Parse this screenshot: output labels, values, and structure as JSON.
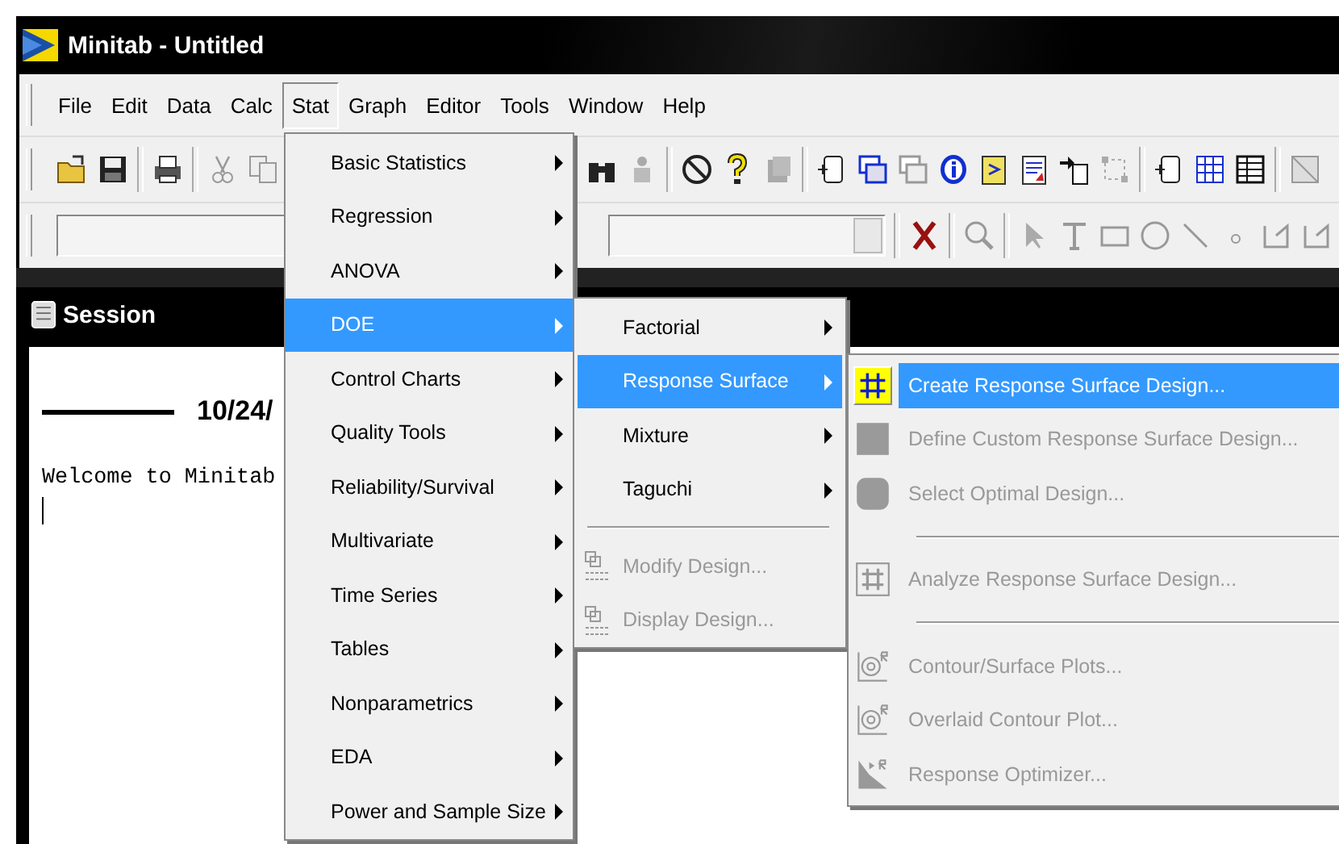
{
  "window": {
    "title": "Minitab - Untitled"
  },
  "menu_bar": [
    {
      "label": "File",
      "selected": false
    },
    {
      "label": "Edit",
      "selected": false
    },
    {
      "label": "Data",
      "selected": false
    },
    {
      "label": "Calc",
      "selected": false
    },
    {
      "label": "Stat",
      "selected": true
    },
    {
      "label": "Graph",
      "selected": false
    },
    {
      "label": "Editor",
      "selected": false
    },
    {
      "label": "Tools",
      "selected": false
    },
    {
      "label": "Window",
      "selected": false
    },
    {
      "label": "Help",
      "selected": false
    }
  ],
  "session": {
    "title": "Session",
    "date": "10/24/",
    "text": "Welcome to Minitab"
  },
  "stat_menu": [
    {
      "label": "Basic Statistics",
      "selected": false,
      "submenu": true
    },
    {
      "label": "Regression",
      "selected": false,
      "submenu": true
    },
    {
      "label": "ANOVA",
      "selected": false,
      "submenu": true
    },
    {
      "label": "DOE",
      "selected": true,
      "submenu": true
    },
    {
      "label": "Control Charts",
      "selected": false,
      "submenu": true
    },
    {
      "label": "Quality Tools",
      "selected": false,
      "submenu": true
    },
    {
      "label": "Reliability/Survival",
      "selected": false,
      "submenu": true
    },
    {
      "label": "Multivariate",
      "selected": false,
      "submenu": true
    },
    {
      "label": "Time Series",
      "selected": false,
      "submenu": true
    },
    {
      "label": "Tables",
      "selected": false,
      "submenu": true
    },
    {
      "label": "Nonparametrics",
      "selected": false,
      "submenu": true
    },
    {
      "label": "EDA",
      "selected": false,
      "submenu": true
    },
    {
      "label": "Power and Sample Size",
      "selected": false,
      "submenu": true
    }
  ],
  "doe_menu": [
    {
      "kind": "item",
      "label": "Factorial",
      "selected": false,
      "disabled": false,
      "submenu": true
    },
    {
      "kind": "item",
      "label": "Response Surface",
      "selected": true,
      "disabled": false,
      "submenu": true
    },
    {
      "kind": "item",
      "label": "Mixture",
      "selected": false,
      "disabled": false,
      "submenu": true
    },
    {
      "kind": "item",
      "label": "Taguchi",
      "selected": false,
      "disabled": false,
      "submenu": true
    },
    {
      "kind": "separator"
    },
    {
      "kind": "item",
      "label": "Modify Design...",
      "selected": false,
      "disabled": true,
      "submenu": false
    },
    {
      "kind": "item",
      "label": "Display Design...",
      "selected": false,
      "disabled": true,
      "submenu": false
    }
  ],
  "response_surface_menu": [
    {
      "kind": "item",
      "label": "Create Response Surface Design...",
      "selected": true,
      "disabled": false
    },
    {
      "kind": "item",
      "label": "Define Custom Response Surface Design...",
      "selected": false,
      "disabled": true
    },
    {
      "kind": "item",
      "label": "Select Optimal Design...",
      "selected": false,
      "disabled": true
    },
    {
      "kind": "separator"
    },
    {
      "kind": "item",
      "label": "Analyze Response Surface Design...",
      "selected": false,
      "disabled": true
    },
    {
      "kind": "separator"
    },
    {
      "kind": "item",
      "label": "Contour/Surface Plots...",
      "selected": false,
      "disabled": true
    },
    {
      "kind": "item",
      "label": "Overlaid Contour Plot...",
      "selected": false,
      "disabled": true
    },
    {
      "kind": "item",
      "label": "Response Optimizer...",
      "selected": false,
      "disabled": true
    }
  ]
}
